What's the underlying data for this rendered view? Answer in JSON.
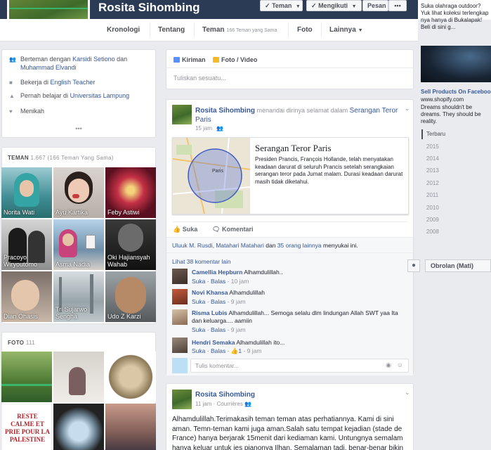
{
  "header": {
    "name": "Rosita Sihombing",
    "btn_friend": "Teman",
    "btn_follow": "Mengikuti",
    "btn_message": "Pesan",
    "btn_more": "•••"
  },
  "nav": {
    "tabs": [
      {
        "label": "Kronologi"
      },
      {
        "label": "Tentang"
      },
      {
        "label": "Teman",
        "sub": "166 Teman yang Sama"
      },
      {
        "label": "Foto"
      },
      {
        "label": "Lainnya"
      }
    ]
  },
  "intro": {
    "row1_pre": "Berteman dengan",
    "row1_link1": "Karsidi Setiono",
    "row1_mid": "dan",
    "row1_link2": "Muhammad Elvandi",
    "row2_pre": "Bekerja di",
    "row2_link": "English Teacher",
    "row3_pre": "Pernah belajar di",
    "row3_link": "Universitas Lampung",
    "row4": "Menikah",
    "more": "•••"
  },
  "friends": {
    "title": "TEMAN",
    "sub": "1.667 (166 Teman Yang Sama)",
    "items": [
      {
        "name": "Norita Wati"
      },
      {
        "name": "Ayu Kartika"
      },
      {
        "name": "Feby Astiwi"
      },
      {
        "name": "Pracoyo Wiryoutomo"
      },
      {
        "name": "Asma Nadia"
      },
      {
        "name": "Oki Hajiansyah Wahab"
      },
      {
        "name": "Dian Ohasis"
      },
      {
        "name": "Tri Sujarwo Sengha"
      },
      {
        "name": "Udo Z Karzi"
      }
    ]
  },
  "photos": {
    "title": "FOTO",
    "sub": "111",
    "poster_text": "RESTE CALME ET PRIE POUR LA PALESTINE"
  },
  "composer": {
    "tab1": "Kiriman",
    "tab2": "Foto / Video",
    "placeholder": "Tuliskan sesuatu..."
  },
  "post1": {
    "author": "Rosita Sihombing",
    "action": "menandai dirinya selamat dalam",
    "event_link": "Serangan Teror Paris",
    "time": "15 jam",
    "card_title": "Serangan Teror Paris",
    "card_desc": "Presiden Prancis, François Hollande, telah menyatakan keadaan darurat di seluruh Prancis setelah serangkaian serangan teror pada Jumat malam. Durasi keadaan darurat masih tidak diketahui.",
    "map_label": "Paris",
    "like": "Suka",
    "comment": "Komentari",
    "likes_names": "Uluuk M. Rusdi, Matahari Matahari",
    "likes_and": "dan",
    "likes_others": "35 orang lainnya",
    "likes_suffix": "menyukai ini.",
    "view_more": "Lihat 38 komentar lain",
    "comments": [
      {
        "name": "Camellia Hepburn",
        "text": "Alhamdulillah..",
        "like": "Suka",
        "reply": "Balas",
        "time": "10 jam"
      },
      {
        "name": "Novi Khansa",
        "text": "Alhamdulillah",
        "like": "Suka",
        "reply": "Balas",
        "time": "9 jam"
      },
      {
        "name": "Risma Lubis",
        "text": "Alhamdulillah... Semoga selalu dlm lindungan Allah SWT yaa Ita dan keluarga.... aamiin",
        "like": "Suka",
        "reply": "Balas",
        "time": "9 jam"
      },
      {
        "name": "Hendri Semaka",
        "text": "Alhamdulillah ito...",
        "like": "Suka",
        "reply": "Balas",
        "count": "1",
        "time": "9 jam"
      }
    ],
    "write_comment": "Tulis komentar..."
  },
  "post2": {
    "author": "Rosita Sihombing",
    "time": "11 jam",
    "location": "Courrières",
    "text": "Alhamdulillah.Terimakasih teman teman atas perhatiannya. Kami di sini aman. Temn-teman kami juga aman.Salah satu tempat kejadian (stade de France) hanya berjarak 15menit dari kediaman kami. Untungnya semalam hanya keluar untuk ies pianonya Ilhan. Semalaman tadi, benar-benar bikin"
  },
  "sidebar": {
    "ad_text_top": "Suka olahraga outdoor? Yuk lihat koleksi terlengkap nya hanya di Bukalapak! Beli di sini g...",
    "ad2_title": "Sell Products On Facebook",
    "ad2_url": "www.shopify.com",
    "ad2_text": "Dreams shouldn't be dreams. They should be reality.",
    "years": [
      "Terbaru",
      "2015",
      "2014",
      "2013",
      "2012",
      "2011",
      "2010",
      "2009",
      "2008"
    ],
    "chat": "Obrolan (Mati)"
  }
}
